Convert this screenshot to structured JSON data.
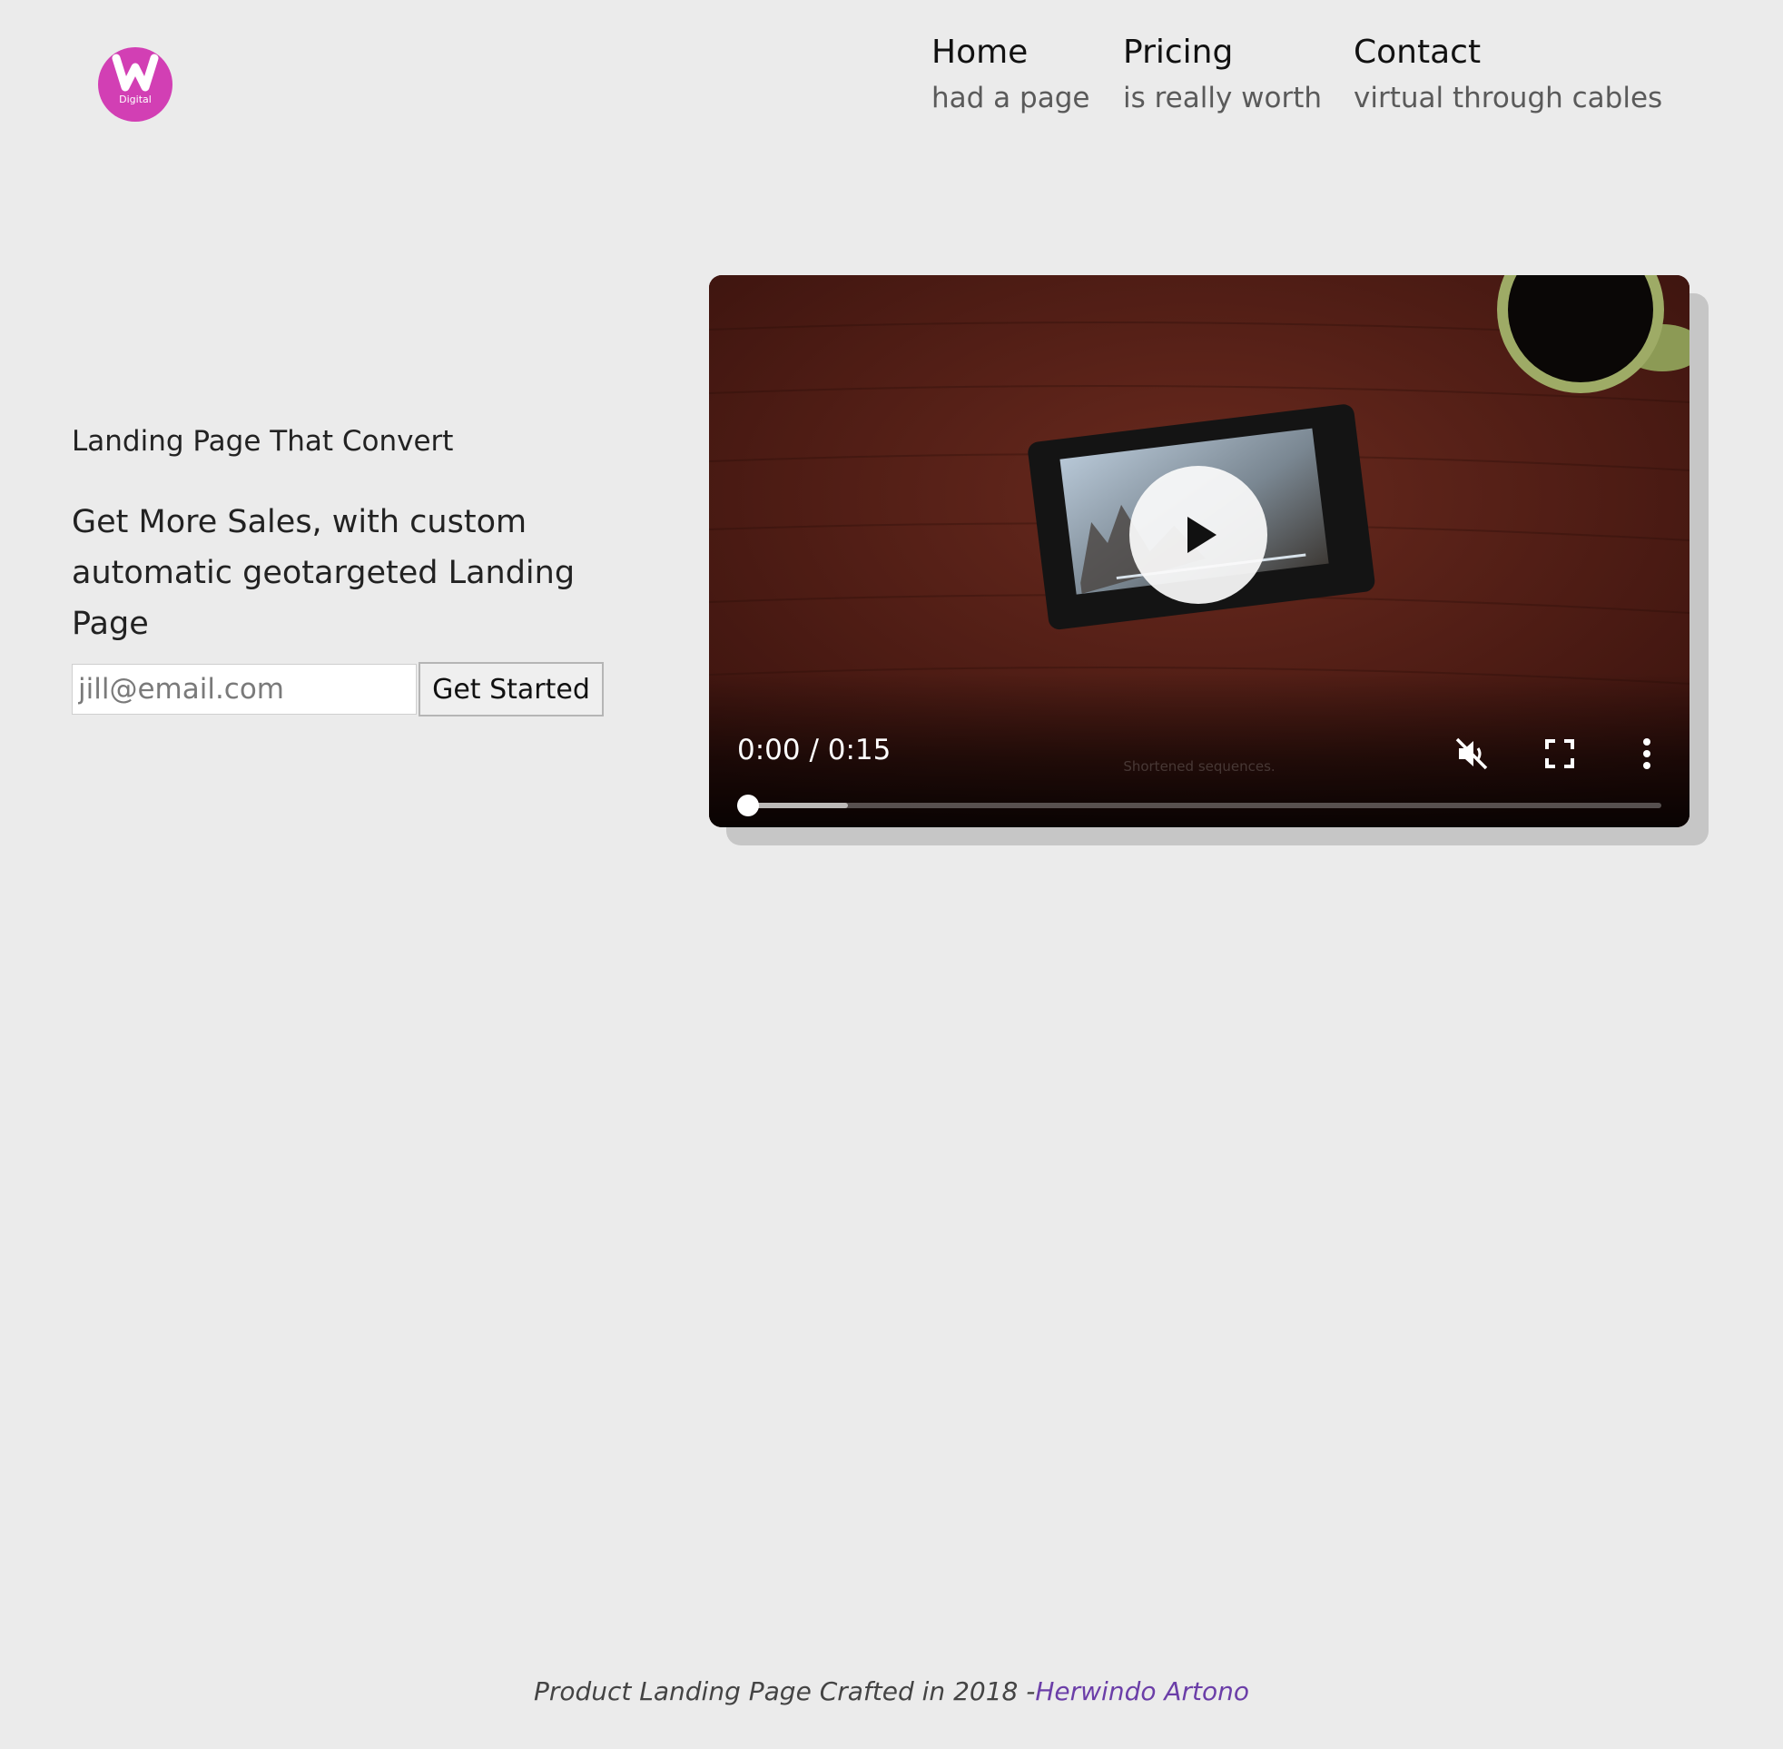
{
  "brand": {
    "logo_letter": "W",
    "logo_subtitle": "Digital",
    "accent": "#d23fb4"
  },
  "nav": [
    {
      "title": "Home",
      "subtitle": "had a page"
    },
    {
      "title": "Pricing",
      "subtitle": "is really worth"
    },
    {
      "title": "Contact",
      "subtitle": "virtual through cables"
    }
  ],
  "hero": {
    "eyebrow": "Landing Page That Convert",
    "headline": "Get More Sales, with custom automatic geotargeted Landing Page",
    "email_placeholder": "jill@email.com",
    "cta_label": "Get Started"
  },
  "video": {
    "current_time": "0:00",
    "duration": "0:15",
    "time_display": "0:00 / 0:15",
    "watermark_text": "Shortened sequences.",
    "played_fraction": 0,
    "buffered_fraction": 0.12,
    "muted": true,
    "icons": {
      "play": "play-icon",
      "mute": "volume-muted-icon",
      "fullscreen": "fullscreen-icon",
      "more": "more-vertical-icon"
    }
  },
  "footer": {
    "text": "Product Landing Page Crafted in 2018 -",
    "author": "Herwindo Artono",
    "link_color": "#6b3ea8"
  }
}
